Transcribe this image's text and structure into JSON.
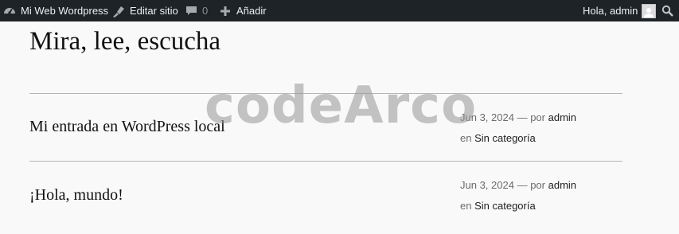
{
  "adminbar": {
    "site_name": "Mi Web Wordpress",
    "edit_label": "Editar sitio",
    "comments_count": "0",
    "add_label": "Añadir",
    "greeting": "Hola, admin",
    "icons": [
      "wordpress-dashboard-icon",
      "brush-icon",
      "comment-icon",
      "plus-icon",
      "avatar",
      "search-icon"
    ]
  },
  "page": {
    "title": "Mira, lee, escucha"
  },
  "posts": [
    {
      "title": "Mi entrada en WordPress local",
      "date": "Jun 3, 2024",
      "dash": "—",
      "by": "por",
      "author": "admin",
      "in": "en",
      "category": "Sin categoría"
    },
    {
      "title": "¡Hola, mundo!",
      "date": "Jun 3, 2024",
      "dash": "—",
      "by": "por",
      "author": "admin",
      "in": "en",
      "category": "Sin categoría"
    }
  ],
  "watermark": "codeArco",
  "colors": {
    "adminbar_bg": "#1d2327",
    "adminbar_text": "#f0f0f1",
    "page_bg": "#f9f9f9"
  }
}
